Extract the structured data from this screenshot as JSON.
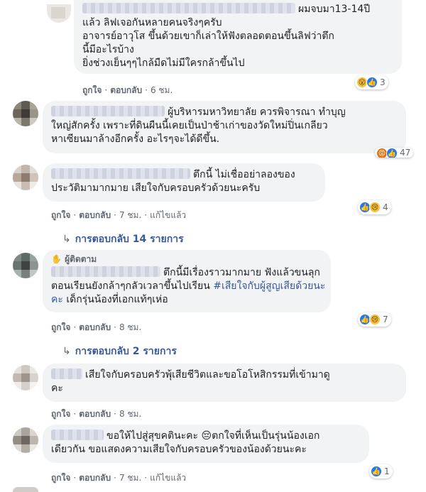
{
  "actions": {
    "like": "ถูกใจ",
    "reply": "ตอบกลับ",
    "edited": "แก้ไขแล้ว"
  },
  "comments": [
    {
      "lines": [
        "ผมจบมา13-14ปี",
        "แล้ว ลิฟเจอกันหลายคนจริงๆครับ",
        "อาจารย์อาวุโส ขึ้นด้วยเขาก็เล่าให้ฟังตลอดตอนขึ้นลิฟว่าตึก",
        "นี้มีอะไรบ้าง",
        "ยิ่งช่วงเย็นๆๆไกล้มืดไม่มีใครกล้าขึ้นไป"
      ],
      "time": "6 ชม.",
      "reactions": "3"
    },
    {
      "lines": [
        "ผู้บริหารมหาวิทยาลัย ควรพิจารณา ทำบุญ",
        "ใหญ่สักครั้ง เพราะที่ดินผืนนี้เคยเป็นป่าช้าเก่าของวัดใหม่ปิ่นเกลียว",
        "หาเซียนมาล้างอีกครั้ง อะไรๆจะได้ดีขึ้น."
      ],
      "reactions": "47"
    },
    {
      "lines": [
        "ตึกนี้ ไม่เชื่ออย่าลองของ",
        "ประวัติมามากมาย เสียใจกับครอบครัวด้วยนะครับ"
      ],
      "time": "7 ชม.",
      "reactions": "4",
      "replies": "การตอบกลับ 14 รายการ"
    },
    {
      "badge": "ผู้ติดตาม",
      "lines": [
        "ตึกนี้มีเรื่องราวมากมาย ฟังแล้วขนลุก",
        "ตอนเรียนยังกล้าๆกลัวเวลาขึ้นไปเรียน",
        "#เสียใจกับผู้สูญเสียด้วยนะ",
        "คะ",
        "เด็กรุ่นน้องที่เอกแท้ๆเห่อ"
      ],
      "time": "8 ชม.",
      "reactions": "7",
      "replies": "การตอบกลับ 2 รายการ"
    },
    {
      "lines": [
        "เสียใจกับครอบครัวพุ้เสียชีวิตและขอโอโหสิกรรมที่เข้ามาดู",
        "คะ"
      ],
      "time": "8 ชม."
    },
    {
      "lines": [
        "ขอให้ไปสู่สุขคตินะคะ",
        "ตกใจที่เห็นเป็นรุ่นน้องเอก",
        "เดียวกัน ขอแสดงความเสียใจกับครอบครัวของน้องด้วยนะคะ"
      ],
      "time": "7 ชม.",
      "reactions": "1"
    }
  ],
  "icons": {
    "like": "like-reaction-icon",
    "wow": "wow-reaction-icon",
    "sad": "sad-reaction-icon",
    "angry": "angry-reaction-icon",
    "reply_arrow": "reply-arrow-icon",
    "fan": "fan-badge-icon",
    "emoji": "pensive-emoji-icon"
  },
  "colors": {
    "bubble": "#f2f3f5",
    "link": "#385898",
    "meta": "#606770",
    "like": "#2078f4"
  }
}
